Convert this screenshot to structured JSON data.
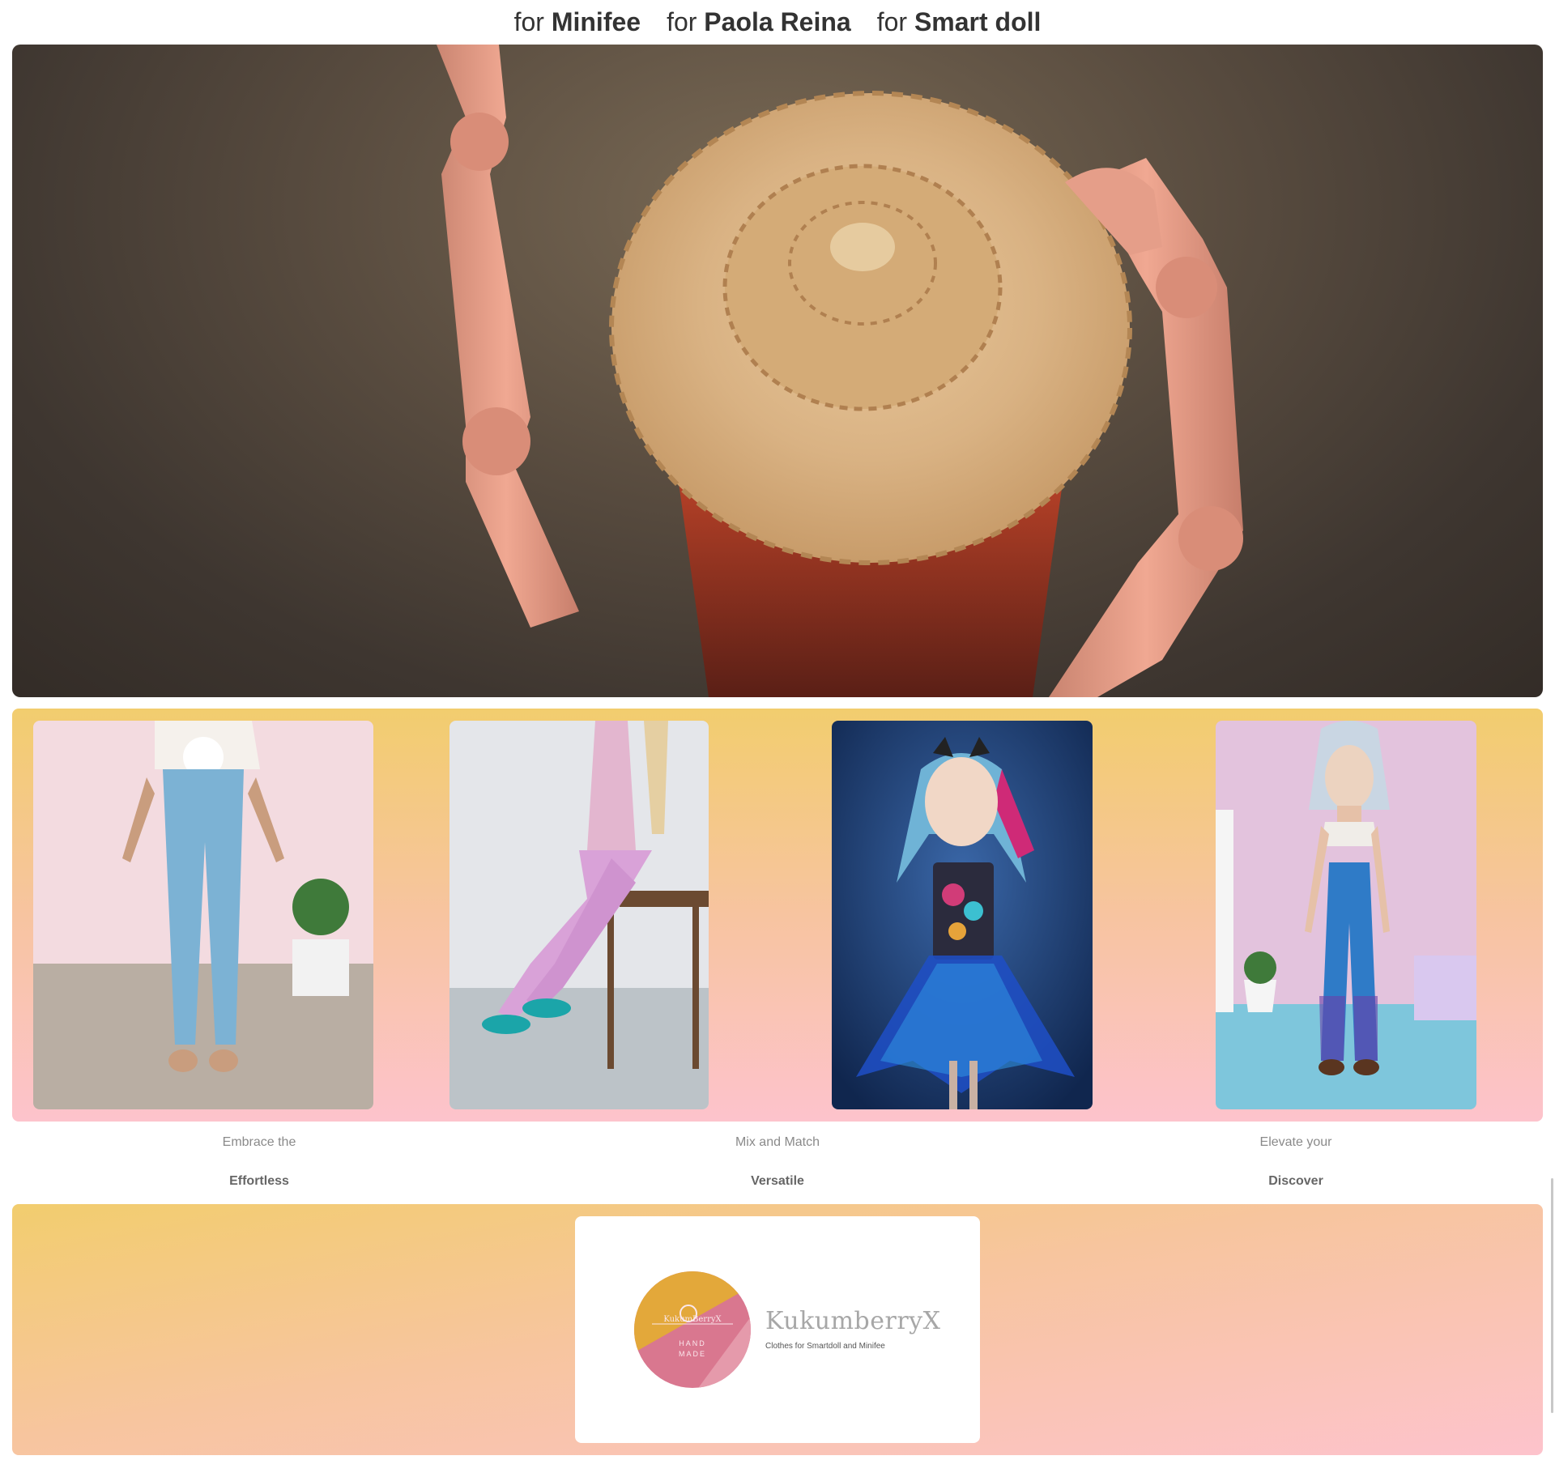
{
  "nav": {
    "items": [
      {
        "prefix": "for ",
        "name": "Minifee"
      },
      {
        "prefix": "for ",
        "name": "Paola Reina"
      },
      {
        "prefix": "for ",
        "name": "Smart doll"
      }
    ]
  },
  "hero": {
    "image": "doll-straw-hat-photo"
  },
  "products": [
    {
      "image": "doll-jeans-bunny-shirt-photo"
    },
    {
      "image": "doll-pink-jeans-stool-photo"
    },
    {
      "image": "doll-blue-tutu-dress-photo"
    },
    {
      "image": "doll-flared-jeans-photo"
    }
  ],
  "captions": [
    {
      "small": "Embrace the",
      "bold": "Effortless"
    },
    {
      "small": "Mix and Match",
      "bold": "Versatile"
    },
    {
      "small": "Elevate your",
      "bold": "Discover"
    }
  ],
  "brand": {
    "name": "KukumberryX",
    "tagline": "Clothes for Smartdoll and Minifee",
    "logo_text": "KukumBerryX",
    "logo_badge": [
      "HAND",
      "MADE"
    ],
    "colors": {
      "logo_pink": "#d9778f",
      "logo_gold": "#e3a83a"
    }
  }
}
